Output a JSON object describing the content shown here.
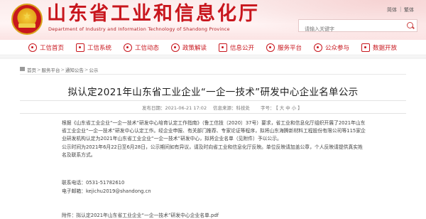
{
  "header": {
    "site_title": "山东省工业和信息化厅",
    "site_subtitle": "Department of Industry and Information Technology of Shandong Province",
    "search_placeholder": "请输入关键字",
    "lang_simplified": "简体",
    "lang_traditional": "繁体",
    "lang_sep": "|",
    "emblem_star": "★",
    "brand_color": "#c8161d"
  },
  "nav": {
    "items": [
      {
        "label": "工信首页",
        "icon": "home-icon"
      },
      {
        "label": "工信系统",
        "icon": "system-icon"
      },
      {
        "label": "工信动态",
        "icon": "news-icon"
      },
      {
        "label": "政策解读",
        "icon": "policy-icon"
      },
      {
        "label": "信息公开",
        "icon": "info-icon"
      },
      {
        "label": "服务平台",
        "icon": "service-icon"
      },
      {
        "label": "公众参与",
        "icon": "public-icon"
      },
      {
        "label": "数据开放",
        "icon": "data-icon"
      }
    ]
  },
  "breadcrumb": {
    "items": [
      "首页",
      "服务平台",
      "通知公告",
      "公示"
    ],
    "sep": ">"
  },
  "article": {
    "title": "拟认定2021年山东省工业企业“一企一技术”研发中心企业名单公示",
    "published_label": "发布日期：",
    "published": "2021-06-21 17:02",
    "source_label": "信息来源：",
    "source": "科技处",
    "font_label": "字号：",
    "font_large": "大",
    "font_medium": "中",
    "font_small": "小",
    "font_open": "【",
    "font_close": "】",
    "paragraphs": [
      "根据《山东省工业企业“一企一技术”研发中心培育认定工作指南》（鲁工信技〔2020〕37号）要求，省工业和信息化厅组织开展了2021年山东省工业企业“一企一技术”研发中心认定工作。经企业申报、有关部门推荐、专家论证等程序，拟将山东海腾新材料工程股份有限公司等115家企业研发机构认定为2021年山东省工业企业“一企一技术”研发中心，拟将企业名单（见附件）予以公示。",
      "公示时间为2021年6月22日至6月28日，公示期间如有异议，请及时向省工业和信息化厅反映。单位反映请加盖公章，个人反映请提供真实姓名及联系方式。"
    ],
    "contact_phone_label": "联系电话：",
    "contact_phone": "0531-51782610",
    "contact_email_label": "电子邮箱：",
    "contact_email": "kejichu2019@shandong.cn",
    "attachment": "附件：拟认定2021年山东省工业企业“一企一技术”研发中心企业名单.pdf"
  }
}
